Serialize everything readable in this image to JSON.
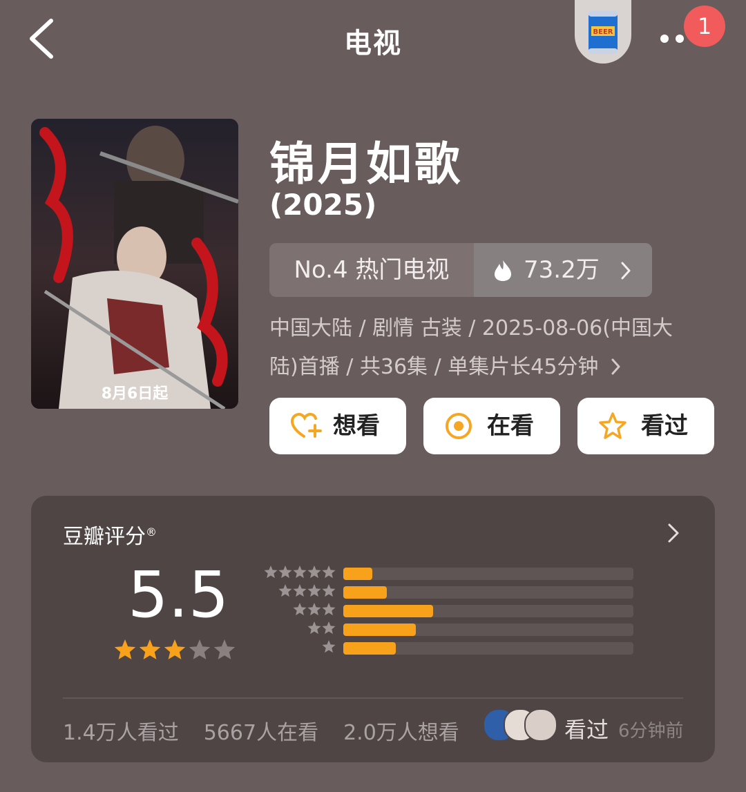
{
  "header": {
    "title": "电视",
    "badge_count": "1",
    "back_icon": "chevron-left-icon",
    "more_icon": "more-dots-icon",
    "beer_icon": "beer-can-icon",
    "beer_label": "BEER"
  },
  "poster": {
    "caption": "8月6日起"
  },
  "show": {
    "title": "锦月如歌",
    "year": "(2025)",
    "rank": "No.4 热门电视",
    "hot_count": "73.2万",
    "meta_line1": "中国大陆 / 剧情 古装 / 2025-08-06(中国大",
    "meta_line2": "陆)首播 / 共36集 / 单集片长45分钟"
  },
  "actions": [
    {
      "label": "想看",
      "icon": "heart-plus-icon"
    },
    {
      "label": "在看",
      "icon": "target-icon"
    },
    {
      "label": "看过",
      "icon": "star-outline-icon"
    }
  ],
  "rating": {
    "title": "豆瓣评分",
    "reg_mark": "®",
    "score": "5.5",
    "stars_filled": 3,
    "stars_total": 5,
    "distribution": [
      {
        "stars": 5,
        "fraction": 0.1
      },
      {
        "stars": 4,
        "fraction": 0.15
      },
      {
        "stars": 3,
        "fraction": 0.31
      },
      {
        "stars": 2,
        "fraction": 0.25
      },
      {
        "stars": 1,
        "fraction": 0.18
      }
    ]
  },
  "stats": {
    "watched": "1.4万人看过",
    "watching": "5667人在看",
    "want": "2.0万人想看",
    "seen_label": "看过",
    "seen_time": "6分钟前"
  },
  "colors": {
    "background": "#685c5c",
    "accent_orange": "#f8a21b",
    "badge_red": "#f15b5b",
    "card": "#4f4545"
  }
}
